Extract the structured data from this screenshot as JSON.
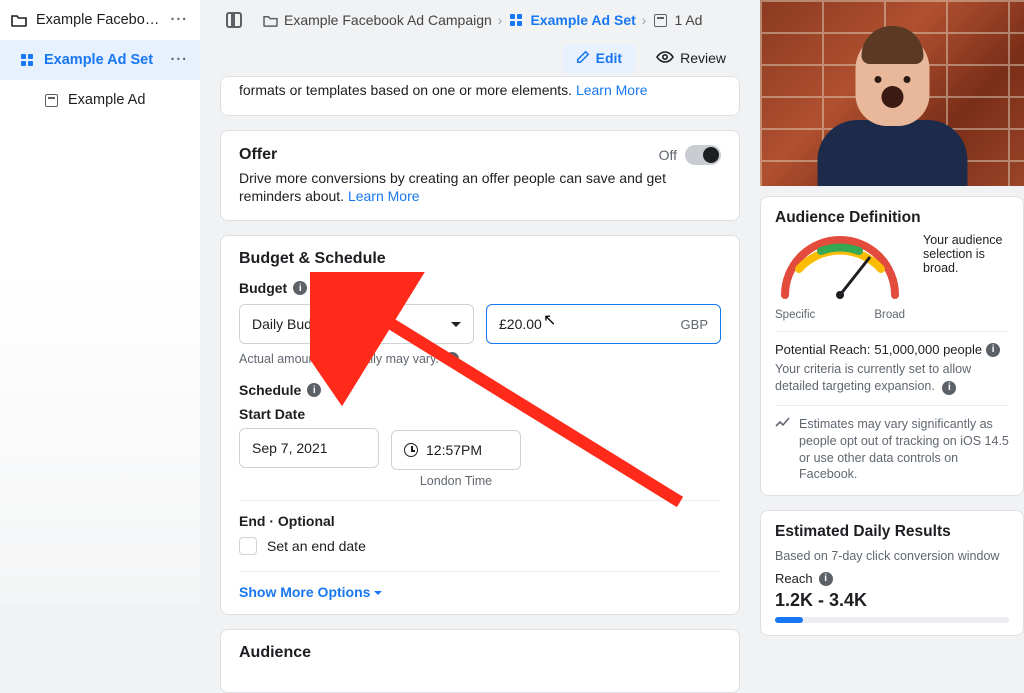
{
  "sidebar": {
    "items": [
      {
        "label": "Example Facebook A...",
        "kind": "campaign"
      },
      {
        "label": "Example Ad Set",
        "kind": "adset",
        "active": true
      },
      {
        "label": "Example Ad",
        "kind": "ad"
      }
    ]
  },
  "breadcrumb": {
    "campaign": "Example Facebook Ad Campaign",
    "adset": "Example Ad Set",
    "ad": "1 Ad"
  },
  "editbar": {
    "edit": "Edit",
    "review": "Review"
  },
  "dynamic_creative_snippet": {
    "text": "formats or templates based on one or more elements.",
    "learn_more": "Learn More"
  },
  "offer": {
    "title": "Offer",
    "desc": "Drive more conversions by creating an offer people can save and get reminders about.",
    "learn_more": "Learn More",
    "toggle_label": "Off"
  },
  "budget_schedule": {
    "title": "Budget & Schedule",
    "budget_label": "Budget",
    "budget_type": "Daily Budget",
    "amount": "£20.00",
    "currency": "GBP",
    "hint": "Actual amount spent daily may vary.",
    "schedule_label": "Schedule",
    "start_date_label": "Start Date",
    "start_date": "Sep 7, 2021",
    "start_time": "12:57PM",
    "timezone": "London Time",
    "end_label": "End",
    "end_optional": " · Optional",
    "end_checkbox": "Set an end date",
    "more_options": "Show More Options"
  },
  "audience_section_title": "Audience",
  "right": {
    "audience_definition": {
      "title": "Audience Definition",
      "specific": "Specific",
      "broad": "Broad",
      "side_note": "Your audience selection is broad.",
      "reach_label": "Potential Reach:",
      "reach_value": "51,000,000 people",
      "criteria": "Your criteria is currently set to allow detailed targeting expansion.",
      "estimates_note": "Estimates may vary significantly as people opt out of tracking on iOS 14.5 or use other data controls on Facebook."
    },
    "est_daily": {
      "title": "Estimated Daily Results",
      "sub": "Based on 7-day click conversion window",
      "reach_label": "Reach",
      "reach_value": "1.2K - 3.4K"
    }
  }
}
